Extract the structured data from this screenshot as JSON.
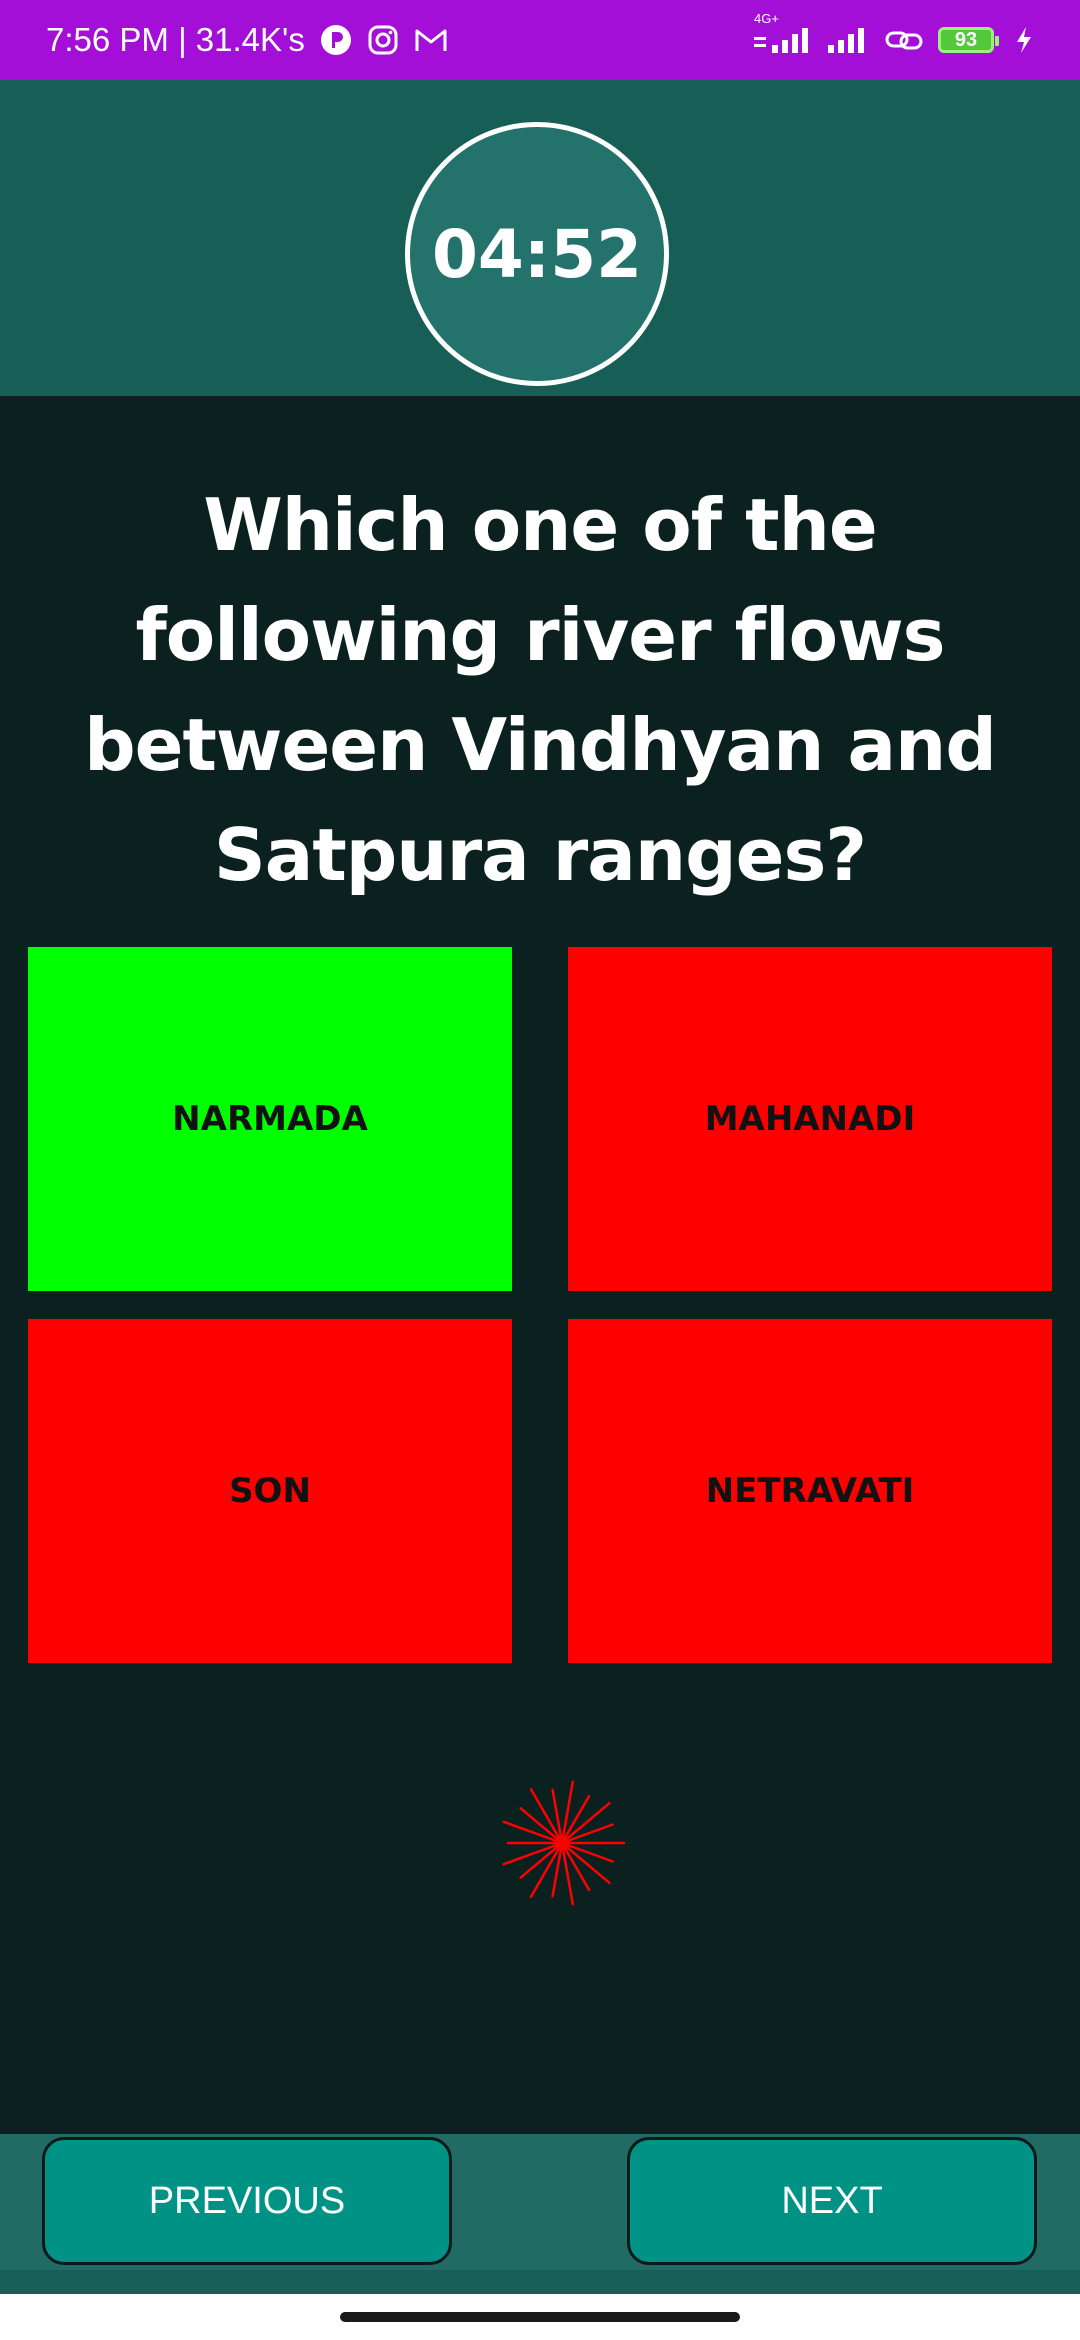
{
  "status_bar": {
    "time_text": "7:56 PM | 31.4K's",
    "network_label": "4G+",
    "battery": "93",
    "icons": [
      "app-notification-icon",
      "instagram-icon",
      "gmail-icon",
      "signal-icon",
      "signal-icon",
      "link-icon",
      "battery-icon",
      "charging-icon"
    ],
    "bg_color": "#a30fd6"
  },
  "timer": {
    "value": "04:52"
  },
  "question": {
    "text": "Which one of the following river flows between Vindhyan and Satpura ranges?"
  },
  "options": [
    {
      "label": "NARMADA",
      "state": "correct",
      "color": "#00ff00"
    },
    {
      "label": "MAHANADI",
      "state": "wrong",
      "color": "#ff0000"
    },
    {
      "label": "SON",
      "state": "wrong",
      "color": "#ff0000"
    },
    {
      "label": "NETRAVATI",
      "state": "wrong",
      "color": "#ff0000"
    }
  ],
  "decoration": {
    "icon": "burst-icon",
    "color": "#ff0000"
  },
  "navigation": {
    "previous_label": "PREVIOUS",
    "next_label": "NEXT"
  },
  "theme": {
    "background": "#0b2120",
    "header": "#175e57",
    "button": "#009385"
  }
}
